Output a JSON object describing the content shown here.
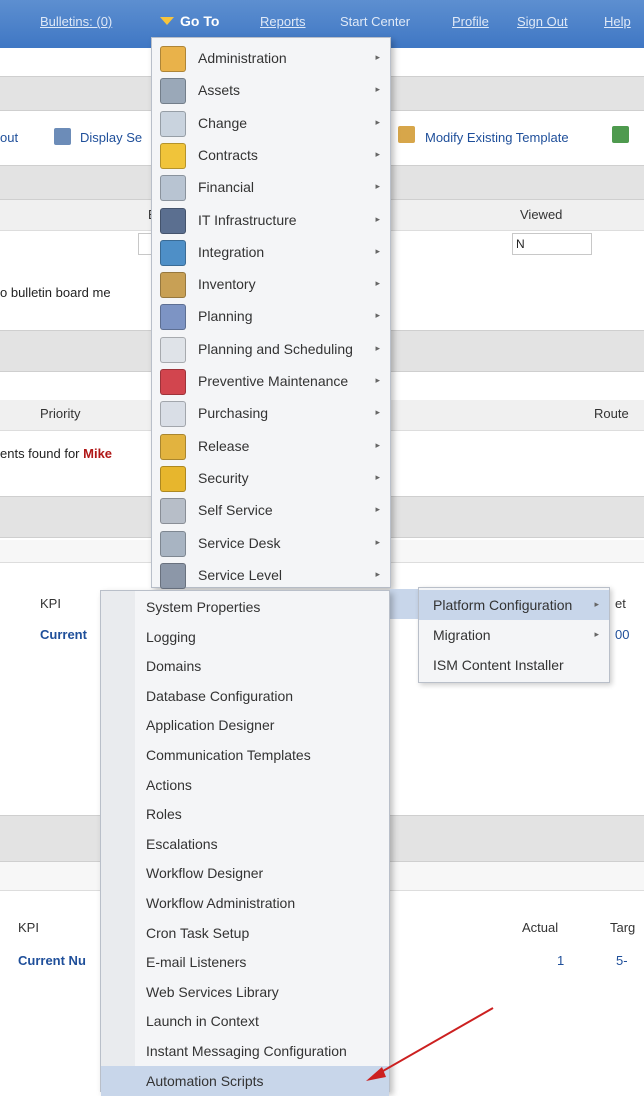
{
  "topnav": {
    "bulletins": "Bulletins: (0)",
    "goto": "Go To",
    "reports": "Reports",
    "start_center": "Start Center",
    "profile": "Profile",
    "sign_out": "Sign Out",
    "help": "Help"
  },
  "toolbar": {
    "layout_fragment": "out",
    "display_settings": "Display Se",
    "modify_template": "Modify Existing Template"
  },
  "bulletin_table": {
    "col_fragment": "E",
    "viewed_header": "Viewed",
    "viewed_value": "N",
    "message_fragment": "o bulletin board me"
  },
  "inbox": {
    "priority_header": "Priority",
    "route_header": "Route",
    "found_text": "ents found for ",
    "user_name": "Mike"
  },
  "kpi1": {
    "kpi_header": "KPI",
    "target_fragment": "et",
    "current_fragment": "Current",
    "value_fragment": "00"
  },
  "kpi2": {
    "kpi_header": "KPI",
    "actual_header": "Actual",
    "target_header": "Targ",
    "current_fragment": "Current Nu",
    "actual_value": "1",
    "target_value": "5-"
  },
  "goto_menu": {
    "items": [
      {
        "label": "Administration",
        "icon": "administration-icon",
        "color": "#e9b24a"
      },
      {
        "label": "Assets",
        "icon": "assets-icon",
        "color": "#9aa8b8"
      },
      {
        "label": "Change",
        "icon": "change-icon",
        "color": "#c9d3de"
      },
      {
        "label": "Contracts",
        "icon": "contracts-icon",
        "color": "#f0c43a"
      },
      {
        "label": "Financial",
        "icon": "financial-icon",
        "color": "#b8c4d2"
      },
      {
        "label": "IT Infrastructure",
        "icon": "it-infrastructure-icon",
        "color": "#5b6f90"
      },
      {
        "label": "Integration",
        "icon": "integration-icon",
        "color": "#4e8fc7"
      },
      {
        "label": "Inventory",
        "icon": "inventory-icon",
        "color": "#c8a055"
      },
      {
        "label": "Planning",
        "icon": "planning-icon",
        "color": "#7d94c4"
      },
      {
        "label": "Planning and Scheduling",
        "icon": "planning-scheduling-icon",
        "color": "#dfe3e8"
      },
      {
        "label": "Preventive Maintenance",
        "icon": "preventive-maintenance-icon",
        "color": "#d2454e"
      },
      {
        "label": "Purchasing",
        "icon": "purchasing-icon",
        "color": "#d9dee6"
      },
      {
        "label": "Release",
        "icon": "release-icon",
        "color": "#e2b33f"
      },
      {
        "label": "Security",
        "icon": "security-icon",
        "color": "#e7b62d"
      },
      {
        "label": "Self Service",
        "icon": "self-service-icon",
        "color": "#b7bec8"
      },
      {
        "label": "Service Desk",
        "icon": "service-desk-icon",
        "color": "#a8b4c2"
      },
      {
        "label": "Service Level",
        "icon": "service-level-icon",
        "color": "#8c97a8"
      }
    ]
  },
  "submenu_platform": {
    "items": [
      {
        "label": "Platform Configuration",
        "has_arrow": true,
        "highlighted": true
      },
      {
        "label": "Migration",
        "has_arrow": true,
        "highlighted": false
      },
      {
        "label": "ISM Content Installer",
        "has_arrow": false,
        "highlighted": false
      }
    ]
  },
  "submenu_config": {
    "items": [
      {
        "label": "System Properties"
      },
      {
        "label": "Logging"
      },
      {
        "label": "Domains"
      },
      {
        "label": "Database Configuration"
      },
      {
        "label": "Application Designer"
      },
      {
        "label": "Communication Templates"
      },
      {
        "label": "Actions"
      },
      {
        "label": "Roles"
      },
      {
        "label": "Escalations"
      },
      {
        "label": "Workflow Designer"
      },
      {
        "label": "Workflow Administration"
      },
      {
        "label": "Cron Task Setup"
      },
      {
        "label": "E-mail Listeners"
      },
      {
        "label": "Web Services Library"
      },
      {
        "label": "Launch in Context"
      },
      {
        "label": "Instant Messaging Configuration"
      },
      {
        "label": "Automation Scripts"
      }
    ],
    "highlighted_item": "Automation Scripts"
  },
  "colors": {
    "nav_blue": "#3f77c4",
    "highlight": "#c8d6ea",
    "arrow_red": "#cc2020"
  }
}
